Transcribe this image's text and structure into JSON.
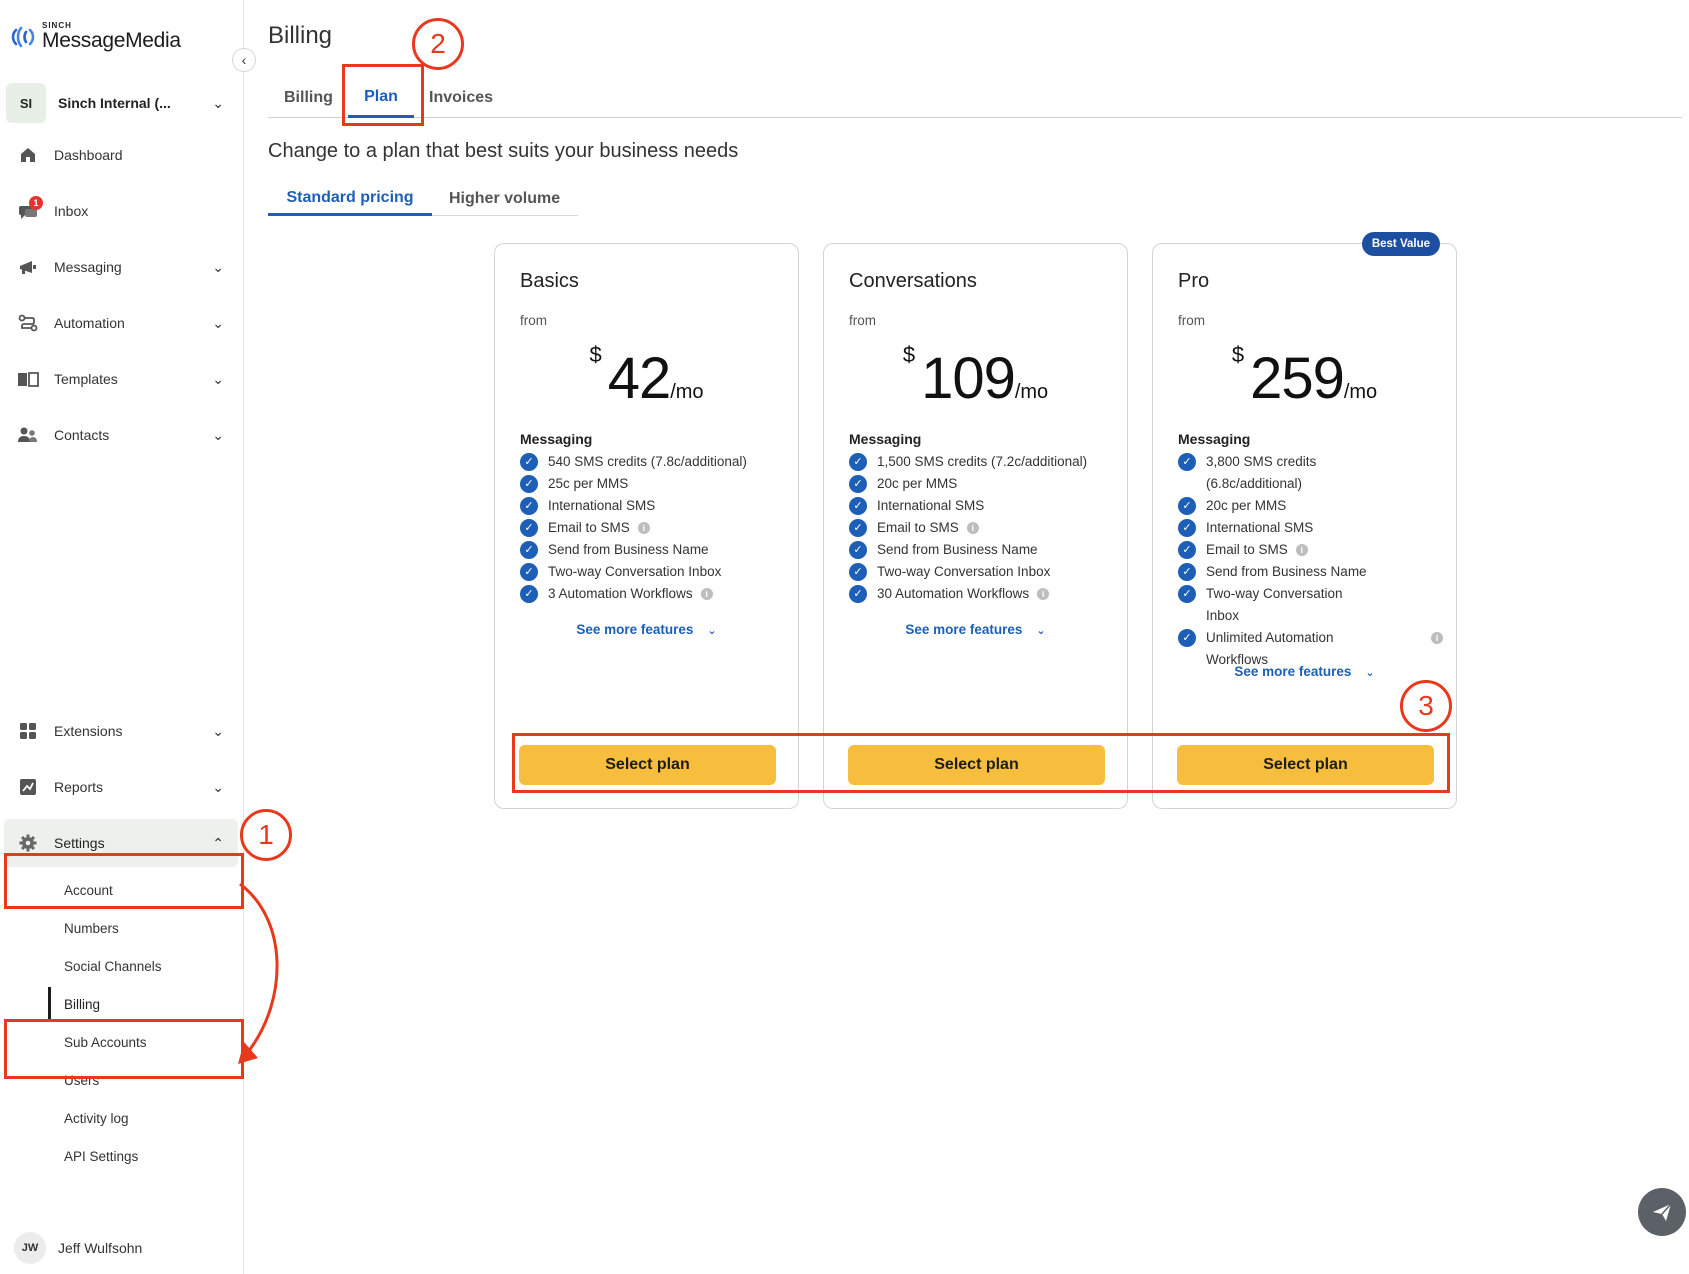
{
  "brand": {
    "sinch": "SINCH",
    "name": "MessageMedia"
  },
  "account": {
    "initials": "SI",
    "name": "Sinch Internal (..."
  },
  "nav": {
    "dashboard": "Dashboard",
    "inbox": "Inbox",
    "inbox_badge": "1",
    "messaging": "Messaging",
    "automation": "Automation",
    "templates": "Templates",
    "contacts": "Contacts",
    "extensions": "Extensions",
    "reports": "Reports",
    "settings": "Settings"
  },
  "settings_sub": {
    "account": "Account",
    "numbers": "Numbers",
    "social": "Social Channels",
    "billing": "Billing",
    "sub_accounts": "Sub Accounts",
    "users": "Users",
    "activity": "Activity log",
    "api": "API Settings"
  },
  "user": {
    "initials": "JW",
    "name": "Jeff Wulfsohn"
  },
  "page": {
    "title": "Billing",
    "tabs": [
      "Billing",
      "Plan",
      "Invoices"
    ],
    "subtitle": "Change to a plan that best suits your business needs",
    "pricing_tabs": [
      "Standard pricing",
      "Higher volume"
    ]
  },
  "plans": [
    {
      "name": "Basics",
      "from": "from",
      "currency": "$",
      "price": "42",
      "per": "/mo",
      "section": "Messaging",
      "features": [
        "540 SMS credits (7.8c/additional)",
        "25c per MMS",
        "International SMS",
        "Email to SMS",
        "Send from Business Name",
        "Two-way Conversation Inbox",
        "3 Automation Workflows"
      ],
      "see_more": "See more features",
      "cta": "Select plan"
    },
    {
      "name": "Conversations",
      "from": "from",
      "currency": "$",
      "price": "109",
      "per": "/mo",
      "section": "Messaging",
      "features": [
        "1,500 SMS credits (7.2c/additional)",
        "20c per MMS",
        "International SMS",
        "Email to SMS",
        "Send from Business Name",
        "Two-way Conversation Inbox",
        "30 Automation Workflows"
      ],
      "see_more": "See more features",
      "cta": "Select plan"
    },
    {
      "name": "Pro",
      "from": "from",
      "currency": "$",
      "price": "259",
      "per": "/mo",
      "badge": "Best Value",
      "section": "Messaging",
      "features": [
        "3,800 SMS credits (6.8c/additional)",
        "20c per MMS",
        "International SMS",
        "Email to SMS",
        "Send from Business Name",
        "Two-way Conversation Inbox",
        "Unlimited Automation Workflows"
      ],
      "see_more": "See more features",
      "cta": "Select plan"
    }
  ],
  "annotations": [
    "1",
    "2",
    "3"
  ],
  "colors": {
    "accent": "#1d5fb6",
    "cta": "#f6be3c",
    "annotation": "#e8391d",
    "badge": "#1d4fa0"
  }
}
